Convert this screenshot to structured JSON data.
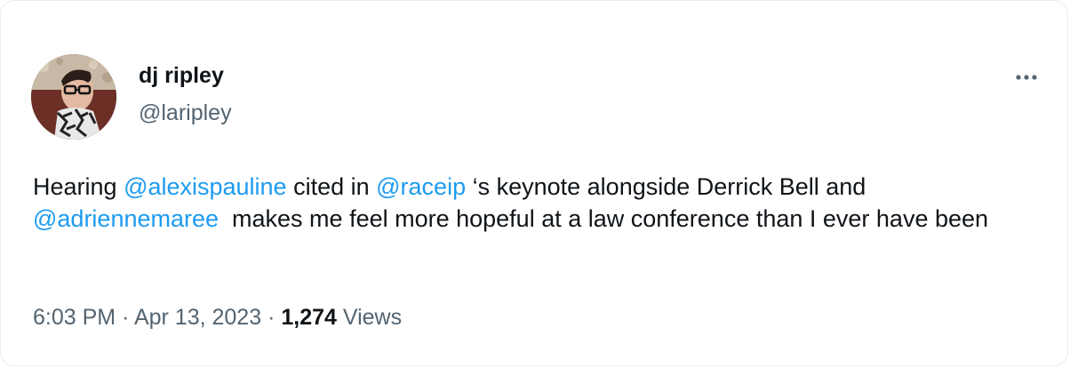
{
  "tweet": {
    "author": {
      "display_name": "dj ripley",
      "handle": "@laripley"
    },
    "text_segments": [
      {
        "type": "text",
        "value": "Hearing "
      },
      {
        "type": "mention",
        "value": "@alexispauline"
      },
      {
        "type": "text",
        "value": " cited in "
      },
      {
        "type": "mention",
        "value": "@raceip"
      },
      {
        "type": "text",
        "value": " ‘s keynote alongside Derrick Bell and "
      },
      {
        "type": "mention",
        "value": "@adriennemaree"
      },
      {
        "type": "text",
        "value": "  makes me feel more hopeful at a law conference than I ever have been"
      }
    ],
    "meta": {
      "time": "6:03 PM",
      "separator": " · ",
      "date": "Apr 13, 2023",
      "view_count": "1,274",
      "views_label": "Views"
    },
    "more_icon": "more-horizontal-icon"
  },
  "colors": {
    "text_primary": "#0f1419",
    "text_secondary": "#536471",
    "link": "#1d9bf0",
    "border": "#e6ecf0"
  }
}
